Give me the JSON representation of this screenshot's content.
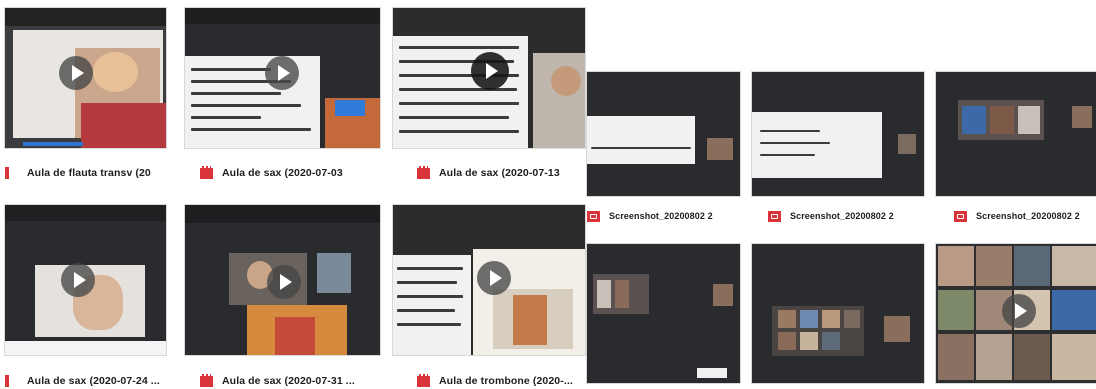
{
  "files": [
    {
      "name": "Aula de flauta transv  (20",
      "type": "video"
    },
    {
      "name": "Aula de sax (2020-07-03",
      "type": "video"
    },
    {
      "name": "Aula de sax (2020-07-13",
      "type": "video"
    },
    {
      "name": "Screenshot_20200802 2",
      "type": "image"
    },
    {
      "name": "Screenshot_20200802 2",
      "type": "image"
    },
    {
      "name": "Screenshot_20200802 2",
      "type": "image"
    },
    {
      "name": "Aula de sax (2020-07-24 ...",
      "type": "video"
    },
    {
      "name": "Aula de sax (2020-07-31 ...",
      "type": "video"
    },
    {
      "name": "Aula de trombone (2020-...",
      "type": "video"
    },
    {
      "type": "image"
    },
    {
      "type": "image"
    },
    {
      "type": "video"
    }
  ],
  "icons": {
    "video": "film-icon",
    "image": "image-icon",
    "play": "play-icon"
  },
  "colors": {
    "file_icon": "#d9343a",
    "label_text": "#1e1e1e",
    "thumb_dark": "#2a2b2e"
  }
}
